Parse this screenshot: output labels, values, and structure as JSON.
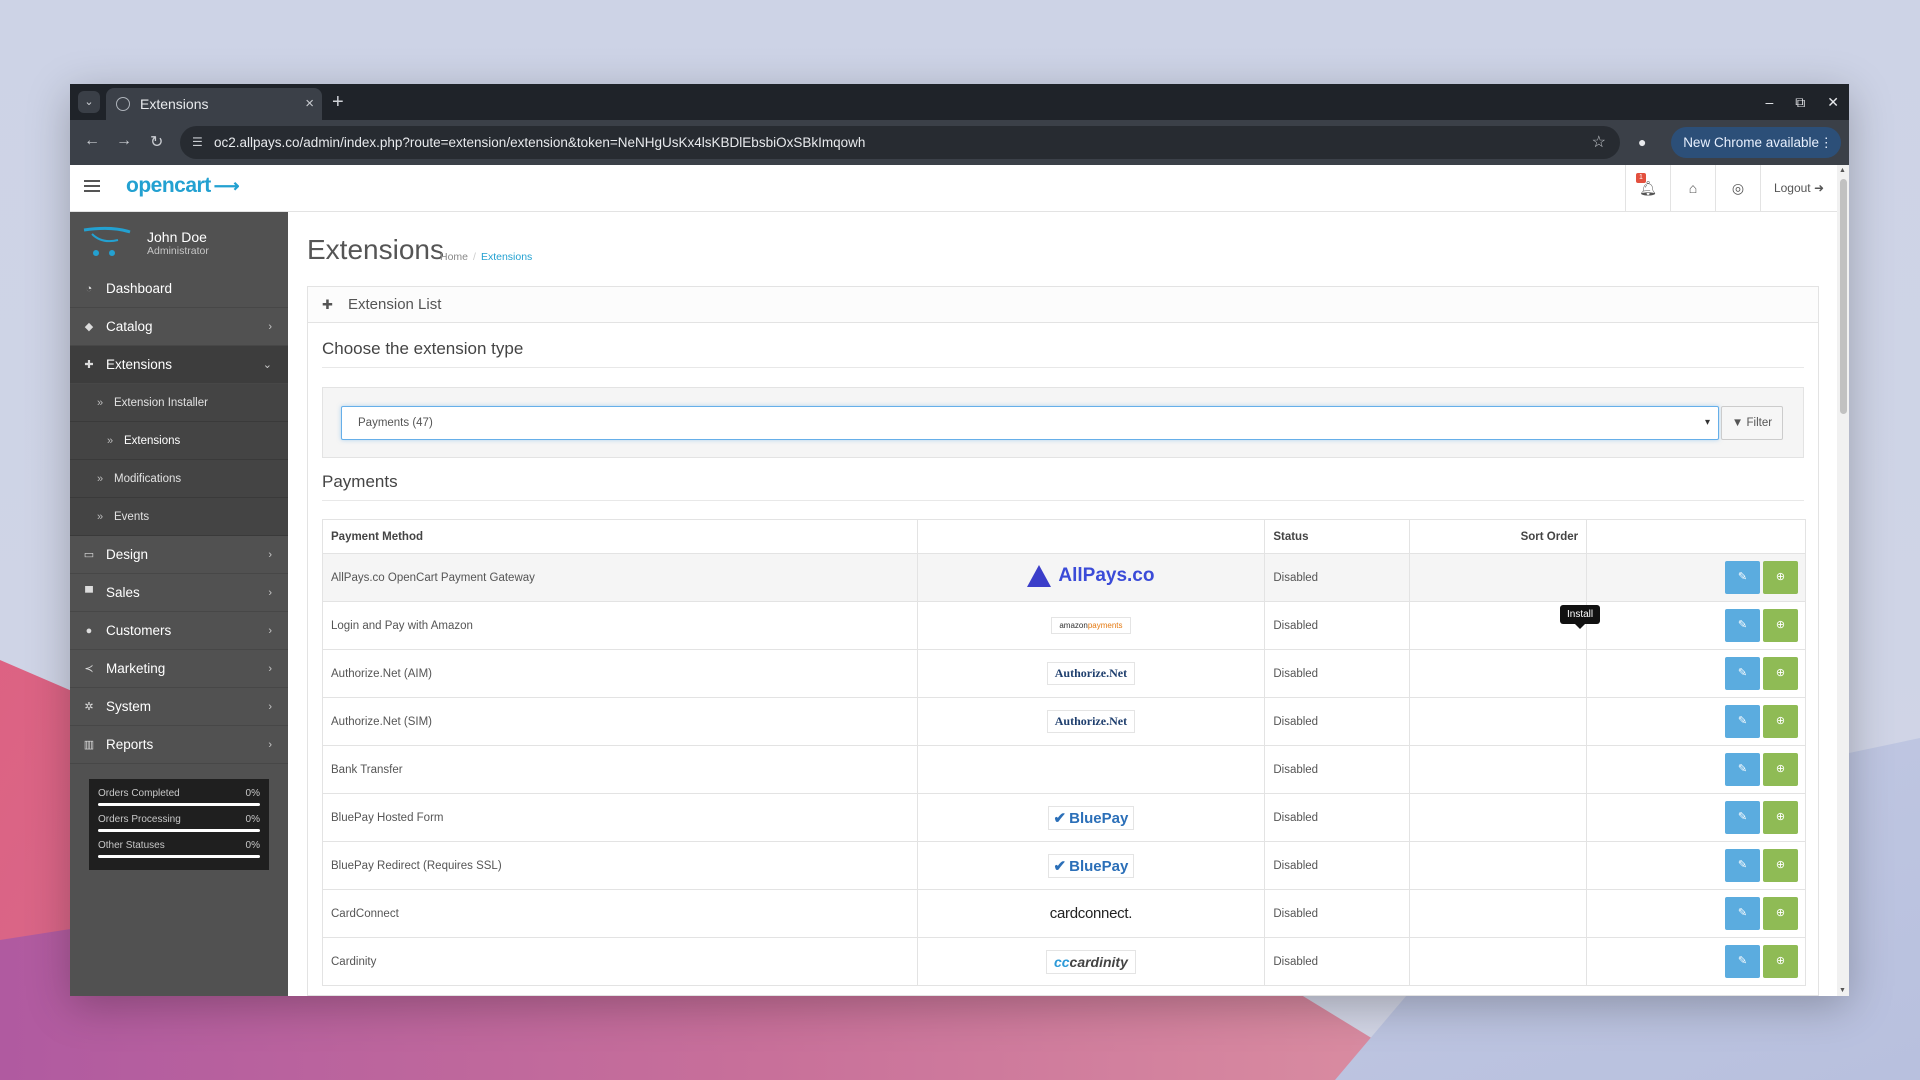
{
  "browser": {
    "tab_title": "Extensions",
    "tab_close": "×",
    "new_tab": "+",
    "url": "oc2.allpays.co/admin/index.php?route=extension/extension&token=NeNHgUsKx4lsKBDlEbsbiOxSBkImqowh",
    "new_chrome_label": "New Chrome available",
    "win_minimize": "–",
    "win_restore": "⧉",
    "win_close": "✕"
  },
  "header": {
    "logo_text": "opencart",
    "logout_label": "Logout",
    "notification_count": "1"
  },
  "sidebar": {
    "user_name": "John Doe",
    "user_role": "Administrator",
    "items": [
      {
        "label": "Dashboard",
        "icon": "dashboard-icon"
      },
      {
        "label": "Catalog",
        "icon": "tag-icon"
      },
      {
        "label": "Extensions",
        "icon": "puzzle-icon"
      },
      {
        "label": "Design",
        "icon": "monitor-icon"
      },
      {
        "label": "Sales",
        "icon": "cart-icon"
      },
      {
        "label": "Customers",
        "icon": "user-icon"
      },
      {
        "label": "Marketing",
        "icon": "share-icon"
      },
      {
        "label": "System",
        "icon": "cog-icon"
      },
      {
        "label": "Reports",
        "icon": "bar-chart-icon"
      }
    ],
    "sub_items": [
      {
        "label": "Extension Installer"
      },
      {
        "label": "Extensions"
      },
      {
        "label": "Modifications"
      },
      {
        "label": "Events"
      }
    ],
    "stats": [
      {
        "label": "Orders Completed",
        "value": "0%",
        "fraction": 0
      },
      {
        "label": "Orders Processing",
        "value": "0%",
        "fraction": 0
      },
      {
        "label": "Other Statuses",
        "value": "0%",
        "fraction": 0
      }
    ]
  },
  "main": {
    "title": "Extensions",
    "breadcrumb_home": "Home",
    "breadcrumb_current": "Extensions",
    "panel_title": "Extension List",
    "choose_title": "Choose the extension type",
    "select_value": "Payments (47)",
    "filter_label": "Filter",
    "section_title": "Payments",
    "columns": {
      "method": "Payment Method",
      "logo": "",
      "status": "Status",
      "sort": "Sort Order",
      "action": ""
    },
    "tooltip": "Install",
    "rows": [
      {
        "name": "AllPays.co OpenCart Payment Gateway",
        "logo": "AllPays.co",
        "status": "Disabled"
      },
      {
        "name": "Login and Pay with Amazon",
        "logo_a": "amazon",
        "logo_b": "payments",
        "status": "Disabled"
      },
      {
        "name": "Authorize.Net (AIM)",
        "logo": "Authorize.Net",
        "status": "Disabled"
      },
      {
        "name": "Authorize.Net (SIM)",
        "logo": "Authorize.Net",
        "status": "Disabled"
      },
      {
        "name": "Bank Transfer",
        "logo": "",
        "status": "Disabled"
      },
      {
        "name": "BluePay Hosted Form",
        "logo": "BluePay",
        "status": "Disabled"
      },
      {
        "name": "BluePay Redirect (Requires SSL)",
        "logo": "BluePay",
        "status": "Disabled"
      },
      {
        "name": "CardConnect",
        "logo": "cardconnect.",
        "status": "Disabled"
      },
      {
        "name": "Cardinity",
        "logo_a": "cc",
        "logo_b": "cardinity",
        "status": "Disabled"
      }
    ]
  },
  "colors": {
    "accent": "#23a1d1",
    "sidebar_bg": "#515151",
    "edit_button": "#5bacdf",
    "install_button": "#8fbb55",
    "chrome_dark": "#1f2329"
  }
}
